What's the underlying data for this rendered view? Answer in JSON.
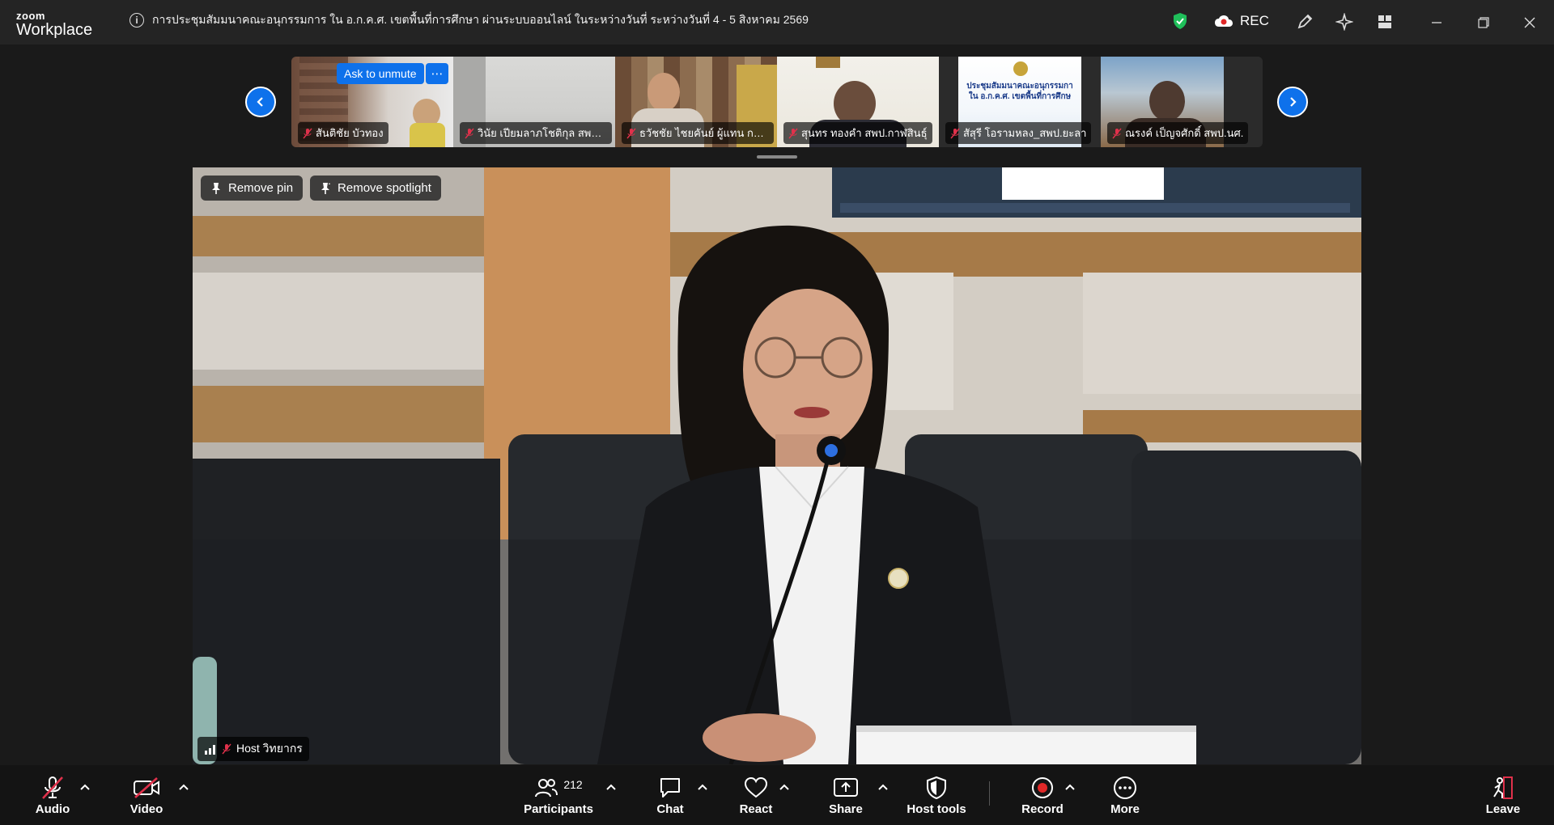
{
  "app": {
    "logo_top": "zoom",
    "logo_bottom": "Workplace"
  },
  "meeting": {
    "title": "การประชุมสัมมนาคณะอนุกรรมการ ใน อ.ก.ค.ศ. เขตพื้นที่การศึกษา ผ่านระบบออนไลน์ ในระหว่างวันที่ ระหว่างวันที่ 4 - 5 สิงหาคม 2569"
  },
  "titlebar": {
    "rec_label": "REC"
  },
  "gallery": {
    "ask_to_unmute": "Ask to unmute",
    "more": "⋯",
    "participants": [
      {
        "name": "สันติชัย บัวทอง"
      },
      {
        "name": "วินัย เปียมลาภโชติกุล สพป.ตราด"
      },
      {
        "name": "ธวัชชัย ไชยคันย์ ผู้แทน กศจ."
      },
      {
        "name": "สุนทร ทองคำ สพป.กาฬสินธุ์"
      },
      {
        "name": "สัสุรี โอรามหลง_สพป.ยะลา"
      },
      {
        "name": "ณรงค์ เป็ญจศักดิ์ สพป.นศ."
      }
    ],
    "strip_slide_text": [
      "ประชุมสัมมนาคณะอนุกรรมกา",
      "ใน อ.ก.ค.ศ. เขตพื้นที่การศึกษ"
    ]
  },
  "main": {
    "remove_pin": "Remove pin",
    "remove_spotlight": "Remove spotlight",
    "host_label": "Host วิทยากร"
  },
  "toolbar": {
    "audio": "Audio",
    "video": "Video",
    "participants": "Participants",
    "participant_count": "212",
    "chat": "Chat",
    "react": "React",
    "share": "Share",
    "host_tools": "Host tools",
    "record": "Record",
    "more": "More",
    "leave": "Leave"
  },
  "colors": {
    "accent": "#0e71eb",
    "record": "#e02828",
    "shield": "#1fbf5a",
    "mic_off": "#e0314b"
  }
}
